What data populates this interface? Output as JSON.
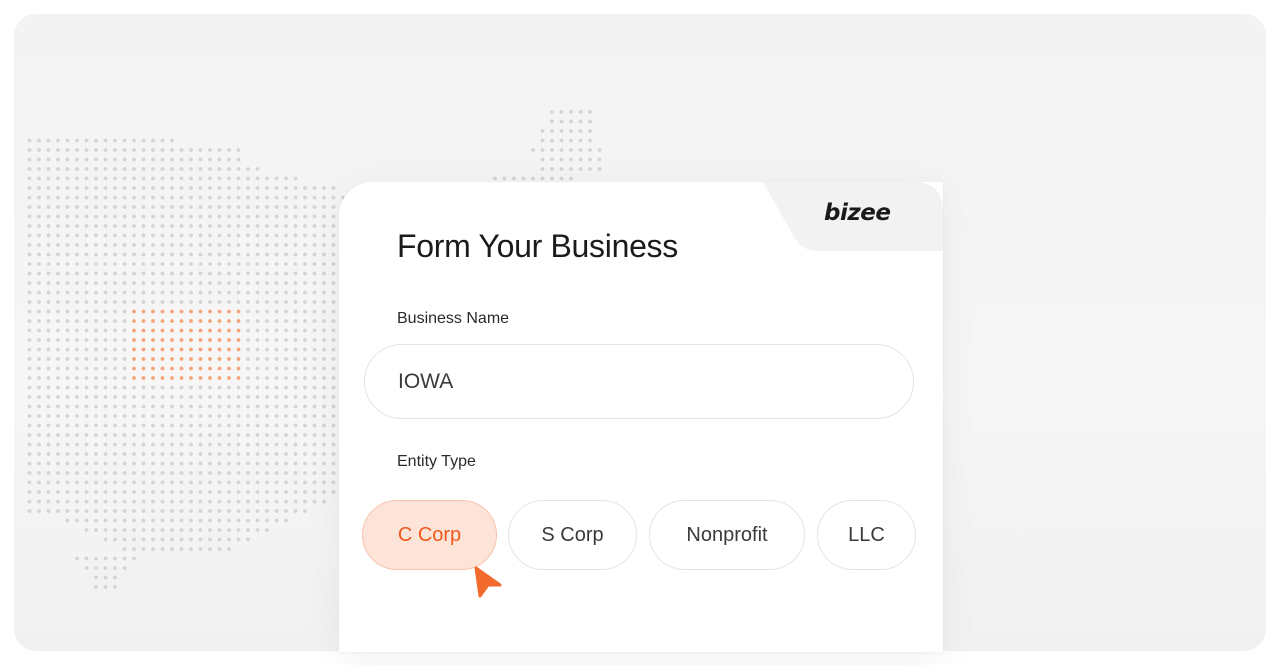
{
  "brand": {
    "logo_text": "bizee",
    "accent_color": "#f26a2e"
  },
  "form": {
    "title": "Form Your Business",
    "business_name": {
      "label": "Business Name",
      "value": "IOWA"
    },
    "entity_type": {
      "label": "Entity Type",
      "options": [
        {
          "label": "C Corp",
          "selected": true
        },
        {
          "label": "S Corp",
          "selected": false
        },
        {
          "label": "Nonprofit",
          "selected": false
        },
        {
          "label": "LLC",
          "selected": false
        }
      ]
    }
  },
  "map": {
    "highlighted_state": "IOWA",
    "highlight_color": "#f4a57a",
    "dot_color": "#d4d4d6"
  },
  "icons": {
    "cursor": "cursor-arrow-icon"
  }
}
